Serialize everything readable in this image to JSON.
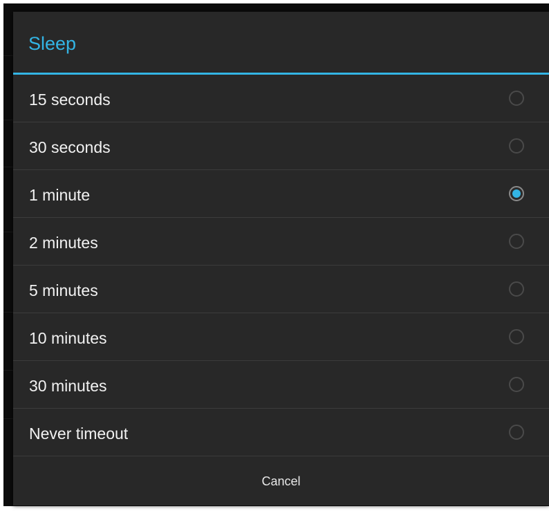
{
  "dialog": {
    "title": "Sleep",
    "accent_color": "#33b5e5",
    "options": [
      {
        "label": "15 seconds",
        "selected": false
      },
      {
        "label": "30 seconds",
        "selected": false
      },
      {
        "label": "1 minute",
        "selected": true
      },
      {
        "label": "2 minutes",
        "selected": false
      },
      {
        "label": "5 minutes",
        "selected": false
      },
      {
        "label": "10 minutes",
        "selected": false
      },
      {
        "label": "30 minutes",
        "selected": false
      },
      {
        "label": "Never timeout",
        "selected": false
      }
    ],
    "cancel_label": "Cancel"
  }
}
